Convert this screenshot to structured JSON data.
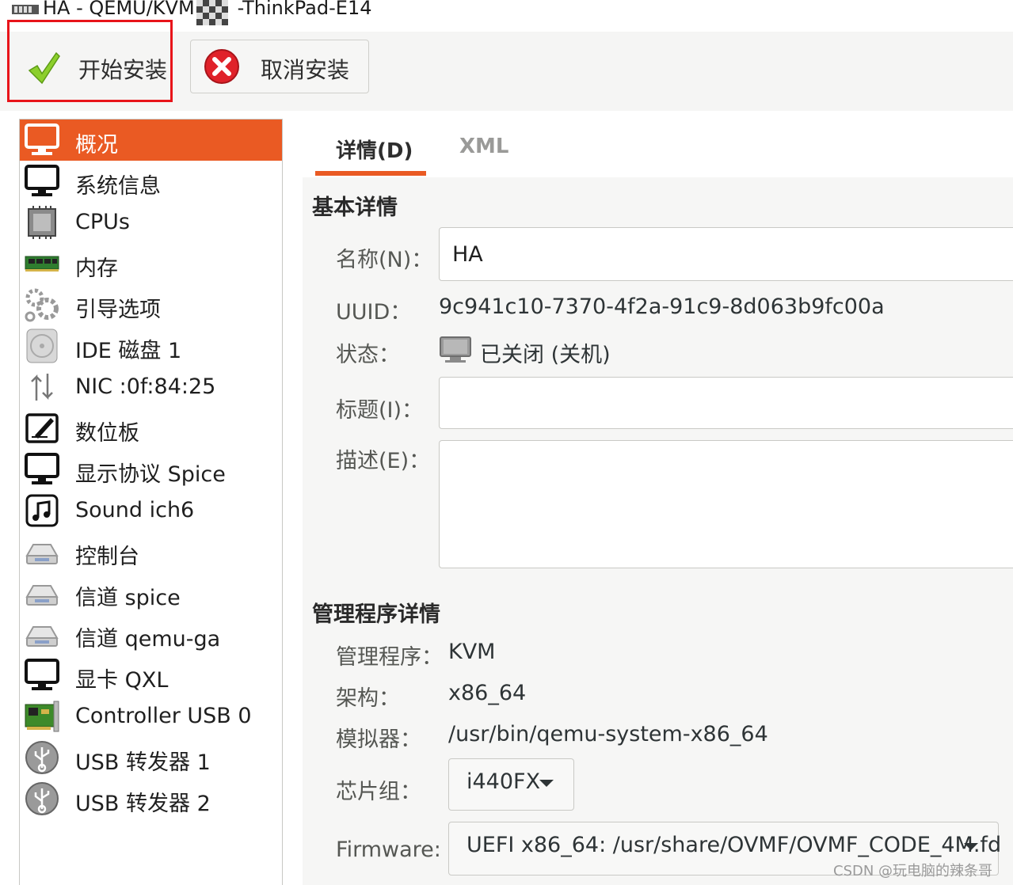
{
  "window": {
    "title_left": "HA - QEMU/KVM",
    "title_right": "-ThinkPad-E14"
  },
  "toolbar": {
    "install_label": "开始安装",
    "cancel_label": "取消安装"
  },
  "sidebar": {
    "items": [
      {
        "label": "概况",
        "icon": "monitor-icon"
      },
      {
        "label": "系统信息",
        "icon": "monitor-icon"
      },
      {
        "label": "CPUs",
        "icon": "cpu-icon"
      },
      {
        "label": "内存",
        "icon": "memory-icon"
      },
      {
        "label": "引导选项",
        "icon": "gears-icon"
      },
      {
        "label": "IDE 磁盘 1",
        "icon": "disk-icon"
      },
      {
        "label": "NIC :0f:84:25",
        "icon": "network-icon"
      },
      {
        "label": "数位板",
        "icon": "tablet-icon"
      },
      {
        "label": "显示协议 Spice",
        "icon": "monitor-icon"
      },
      {
        "label": "Sound ich6",
        "icon": "sound-icon"
      },
      {
        "label": "控制台",
        "icon": "serial-icon"
      },
      {
        "label": "信道 spice",
        "icon": "serial-icon"
      },
      {
        "label": "信道 qemu-ga",
        "icon": "serial-icon"
      },
      {
        "label": "显卡 QXL",
        "icon": "monitor-icon"
      },
      {
        "label": "Controller USB 0",
        "icon": "pci-card-icon"
      },
      {
        "label": "USB 转发器 1",
        "icon": "usb-icon"
      },
      {
        "label": "USB 转发器 2",
        "icon": "usb-icon"
      }
    ],
    "selected_index": 0
  },
  "tabs": {
    "details": "详情(D)",
    "xml": "XML"
  },
  "basic": {
    "section_title": "基本详情",
    "name_label": "名称(N)：",
    "name_value": "HA",
    "uuid_label": "UUID：",
    "uuid_value": "9c941c10-7370-4f2a-91c9-8d063b9fc00a",
    "status_label": "状态：",
    "status_value": "已关闭 (关机)",
    "title_label": "标题(I)：",
    "title_value": "",
    "desc_label": "描述(E)：",
    "desc_value": ""
  },
  "hypervisor": {
    "section_title": "管理程序详情",
    "hv_label": "管理程序：",
    "hv_value": "KVM",
    "arch_label": "架构：",
    "arch_value": "x86_64",
    "emu_label": "模拟器：",
    "emu_value": "/usr/bin/qemu-system-x86_64",
    "chipset_label": "芯片组：",
    "chipset_value": "i440FX",
    "firmware_label": "Firmware:",
    "firmware_value": "UEFI x86_64: /usr/share/OVMF/OVMF_CODE_4M.fd"
  },
  "watermark": "CSDN @玩电脑的辣条哥",
  "colors": {
    "accent": "#ea5a23",
    "highlight_box": "#e8141a"
  }
}
